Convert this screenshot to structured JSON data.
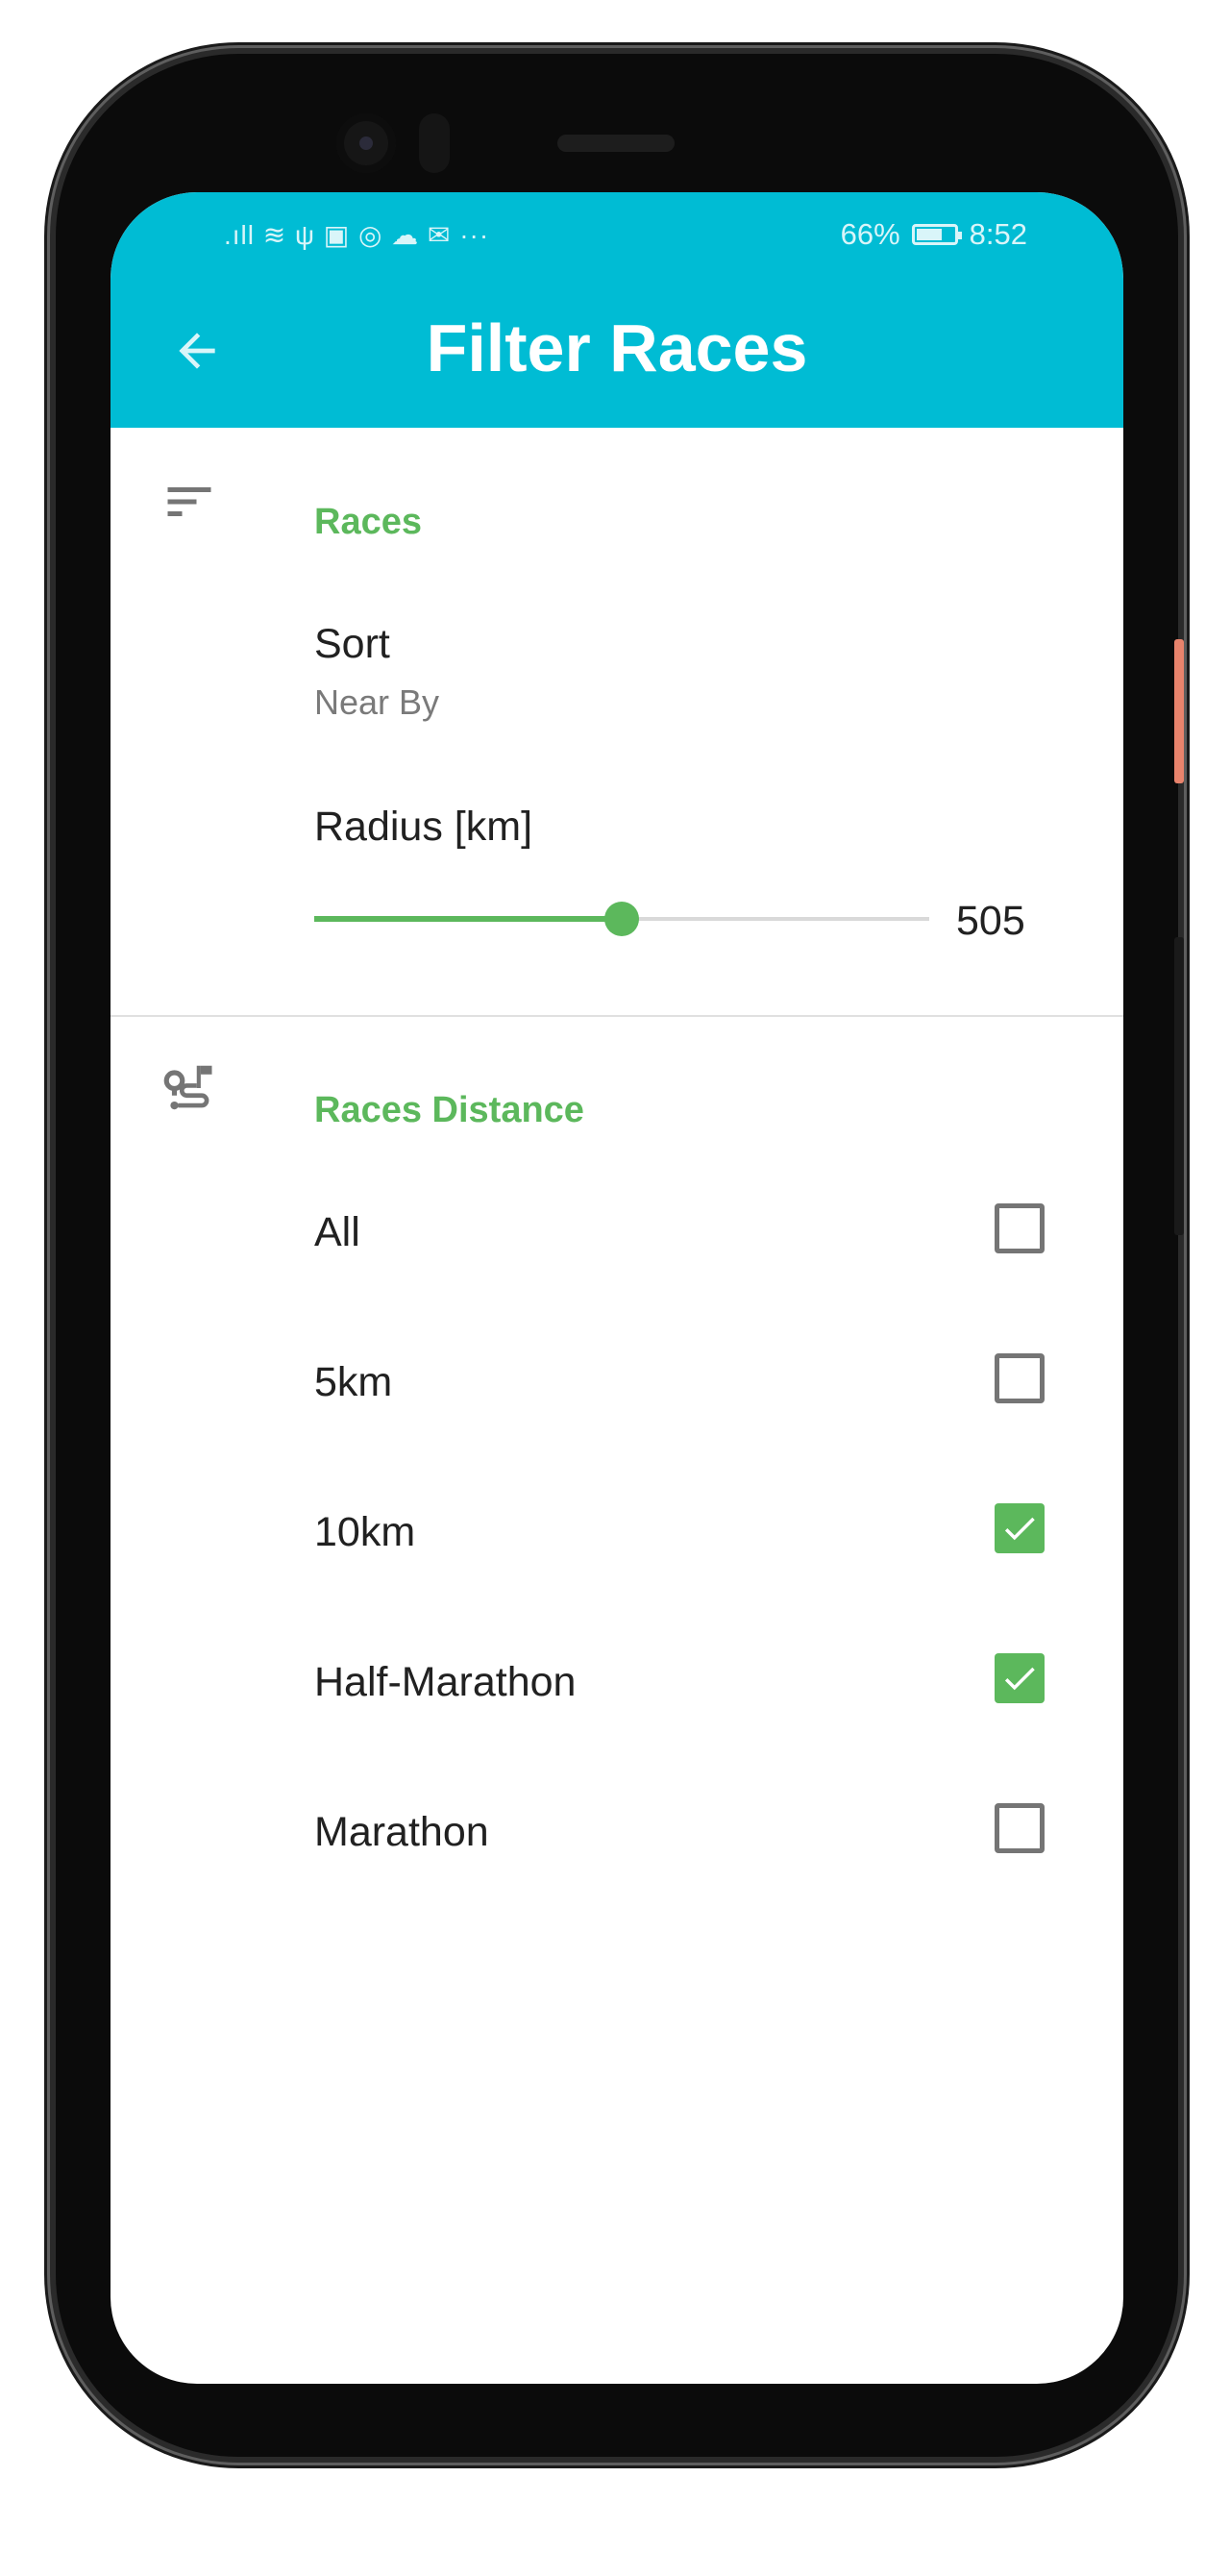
{
  "status_bar": {
    "left_icons": [
      "signal-icon",
      "wifi-icon",
      "usb-icon",
      "app-icon",
      "messenger-icon",
      "cloud-icon",
      "mail-icon",
      "more-icon"
    ],
    "left_text": ".ıll ≋ ψ ▣ ◎ ☁ ✉ ···",
    "battery_percent": "66%",
    "time": "8:52"
  },
  "appbar": {
    "title": "Filter Races",
    "back_icon": "arrow-back-icon",
    "color": "#00bcd4"
  },
  "races_section": {
    "icon": "sort-icon",
    "title": "Races",
    "sort_label": "Sort",
    "sort_value": "Near By",
    "radius_label": "Radius [km]",
    "radius_value": "505",
    "radius_fill_fraction": 0.5
  },
  "distance_section": {
    "icon": "route-icon",
    "title": "Races Distance",
    "options": [
      {
        "label": "All",
        "checked": false
      },
      {
        "label": "5km",
        "checked": false
      },
      {
        "label": "10km",
        "checked": true
      },
      {
        "label": "Half-Marathon",
        "checked": true
      },
      {
        "label": "Marathon",
        "checked": false
      }
    ]
  },
  "accent_color": "#5cb85c"
}
